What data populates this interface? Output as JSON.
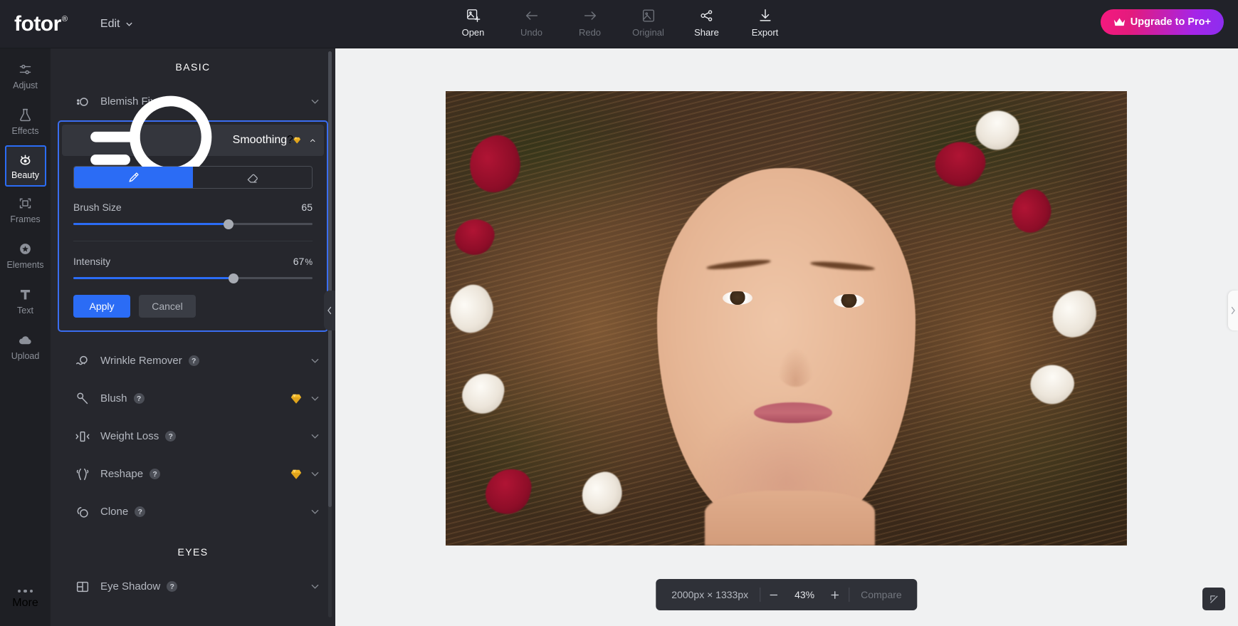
{
  "app": {
    "logo": "fotor",
    "logo_trademark": "®",
    "edit_menu": "Edit",
    "upgrade_button": "Upgrade to Pro+",
    "accent_blue": "#2b6cf5",
    "brand_pink": "#f5197f",
    "brand_purple": "#8b2ef0",
    "gem_gold": "#f2b829"
  },
  "toolbar": [
    {
      "label": "Open",
      "icon": "open-image-icon",
      "state": "active"
    },
    {
      "label": "Undo",
      "icon": "undo-arrow-icon",
      "state": "disabled"
    },
    {
      "label": "Redo",
      "icon": "redo-arrow-icon",
      "state": "disabled"
    },
    {
      "label": "Original",
      "icon": "image-icon",
      "state": "disabled"
    },
    {
      "label": "Share",
      "icon": "share-nodes-icon",
      "state": "active"
    },
    {
      "label": "Export",
      "icon": "download-icon",
      "state": "active"
    }
  ],
  "sidebar": {
    "items": [
      {
        "label": "Adjust",
        "icon": "sliders-icon",
        "selected": false
      },
      {
        "label": "Effects",
        "icon": "flask-icon",
        "selected": false
      },
      {
        "label": "Beauty",
        "icon": "eye-lash-icon",
        "selected": true
      },
      {
        "label": "Frames",
        "icon": "frame-icon",
        "selected": false
      },
      {
        "label": "Elements",
        "icon": "star-icon",
        "selected": false
      },
      {
        "label": "Text",
        "icon": "text-t-icon",
        "selected": false
      },
      {
        "label": "Upload",
        "icon": "upload-cloud-icon",
        "selected": false
      }
    ],
    "more": {
      "label": "More",
      "icon": "ellipsis-icon"
    }
  },
  "panel": {
    "sections": [
      {
        "title": "BASIC",
        "items": [
          {
            "label": "Blemish Fix",
            "icon": "blemish-fix-icon",
            "pro": false,
            "expanded": false
          },
          {
            "label": "Smoothing",
            "icon": "smoothing-icon",
            "pro": true,
            "expanded": true
          },
          {
            "label": "Wrinkle Remover",
            "icon": "wrinkle-remover-icon",
            "pro": false,
            "expanded": false
          },
          {
            "label": "Blush",
            "icon": "blush-icon",
            "pro": true,
            "expanded": false
          },
          {
            "label": "Weight Loss",
            "icon": "weight-loss-icon",
            "pro": false,
            "expanded": false
          },
          {
            "label": "Reshape",
            "icon": "reshape-icon",
            "pro": true,
            "expanded": false
          },
          {
            "label": "Clone",
            "icon": "clone-icon",
            "pro": false,
            "expanded": false
          }
        ]
      },
      {
        "title": "EYES",
        "items": [
          {
            "label": "Eye Shadow",
            "icon": "eye-shadow-icon",
            "pro": false,
            "expanded": false
          }
        ]
      }
    ],
    "help_glyph": "?",
    "smoothing": {
      "modes": [
        {
          "name": "brush-mode",
          "icon": "brush-icon",
          "active": true
        },
        {
          "name": "eraser-mode",
          "icon": "eraser-icon",
          "active": false
        }
      ],
      "brush_size": {
        "label": "Brush Size",
        "value": "65",
        "percent": 65
      },
      "intensity": {
        "label": "Intensity",
        "value": "67",
        "unit": "%",
        "percent": 67
      },
      "apply_label": "Apply",
      "cancel_label": "Cancel"
    }
  },
  "canvas": {
    "collapse_left_icon": "chevron-left-icon",
    "collapse_right_icon": "chevron-right-icon",
    "fit_button_icon": "expand-arrow-icon",
    "bottom_bar": {
      "dimensions": "2000px × 1333px",
      "zoom_out_icon": "minus-icon",
      "zoom_level": "43%",
      "zoom_in_icon": "plus-icon",
      "compare_label": "Compare"
    }
  }
}
